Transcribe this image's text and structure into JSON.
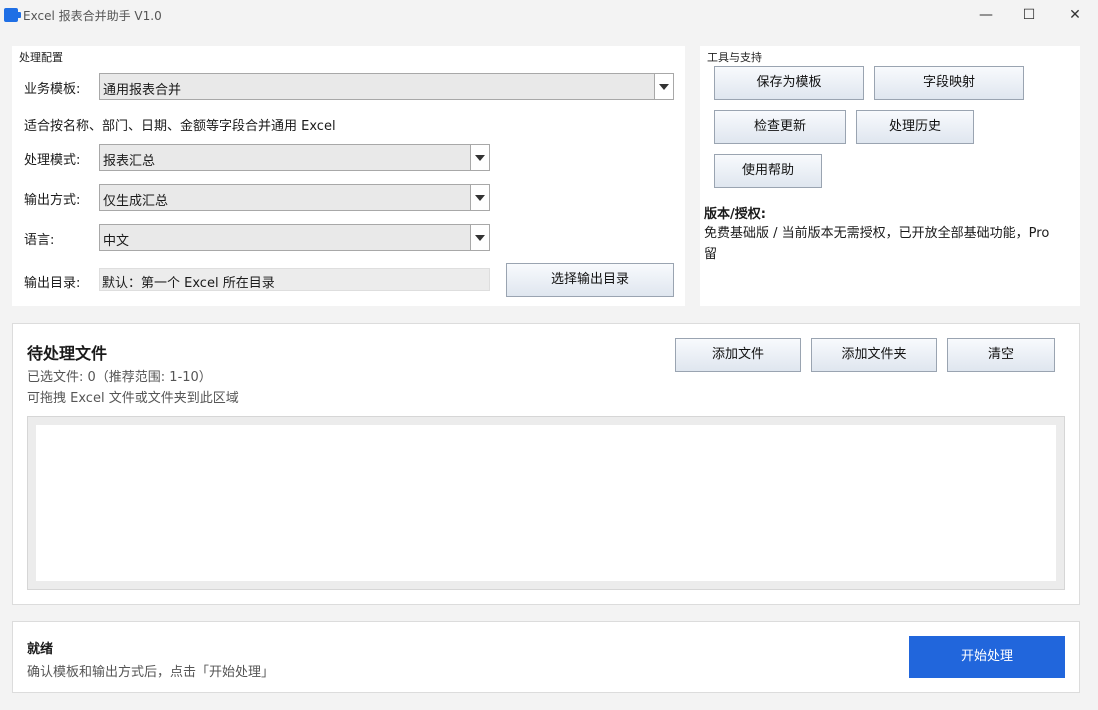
{
  "window": {
    "title": "Excel 报表合并助手 V1.0",
    "minimize_glyph": "—",
    "maximize_glyph": "☐",
    "close_glyph": "✕"
  },
  "config": {
    "group_title": "处理配置",
    "template_label": "业务模板:",
    "template_value": "通用报表合并",
    "template_hint": "适合按名称、部门、日期、金额等字段合并通用 Excel",
    "mode_label": "处理模式:",
    "mode_value": "报表汇总",
    "output_mode_label": "输出方式:",
    "output_mode_value": "仅生成汇总",
    "language_label": "语言:",
    "language_value": "中文",
    "output_dir_label": "输出目录:",
    "output_dir_value": "默认：第一个 Excel 所在目录",
    "choose_dir_button": "选择输出目录"
  },
  "tools": {
    "group_title": "工具与支持",
    "save_template": "保存为模板",
    "field_mapping": "字段映射",
    "check_update": "检查更新",
    "history": "处理历史",
    "help": "使用帮助",
    "license_title": "版本/授权:",
    "license_line1": "免费基础版 / 当前版本无需授权，已开放全部基础功能，Pro",
    "license_line2": "留"
  },
  "files": {
    "title": "待处理文件",
    "count_text": "已选文件: 0（推荐范围: 1-10）",
    "drag_hint": "可拖拽 Excel 文件或文件夹到此区域",
    "add_files": "添加文件",
    "add_folder": "添加文件夹",
    "clear": "清空"
  },
  "status": {
    "title": "就绪",
    "message": "确认模板和输出方式后，点击「开始处理」",
    "start_button": "开始处理"
  },
  "colors": {
    "accent": "#2166dc",
    "window_bg": "#f3f3f3",
    "panel_bg": "#ffffff"
  }
}
